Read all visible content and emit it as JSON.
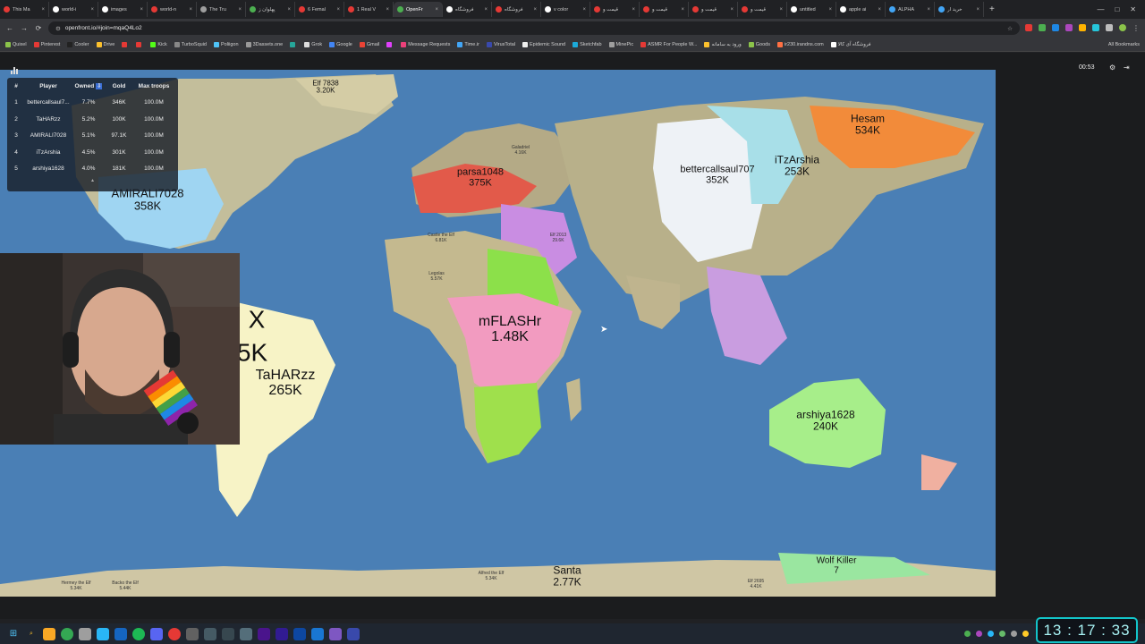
{
  "browser": {
    "tabs": [
      {
        "label": "This Ma",
        "color": "#e53935",
        "active": false
      },
      {
        "label": "world-i",
        "color": "#ffffff",
        "active": false
      },
      {
        "label": "images",
        "color": "#ffffff",
        "active": false
      },
      {
        "label": "world-n",
        "color": "#e53935",
        "active": false
      },
      {
        "label": "The Tru",
        "color": "#9e9e9e",
        "active": false
      },
      {
        "label": "پهلوان ز",
        "color": "#4caf50",
        "active": false
      },
      {
        "label": "6 Femal",
        "color": "#e53935",
        "active": false
      },
      {
        "label": "1 Real V",
        "color": "#e53935",
        "active": false
      },
      {
        "label": "OpenFr",
        "color": "#4caf50",
        "active": true
      },
      {
        "label": "فروشگاه",
        "color": "#ffffff",
        "active": false
      },
      {
        "label": "فروشگاه",
        "color": "#e53935",
        "active": false
      },
      {
        "label": "v color",
        "color": "#ffffff",
        "active": false
      },
      {
        "label": "قیمت و",
        "color": "#e53935",
        "active": false
      },
      {
        "label": "قیمت و",
        "color": "#e53935",
        "active": false
      },
      {
        "label": "قیمت و",
        "color": "#e53935",
        "active": false
      },
      {
        "label": "قیمت و",
        "color": "#e53935",
        "active": false
      },
      {
        "label": "untitled",
        "color": "#ffffff",
        "active": false
      },
      {
        "label": "apple ai",
        "color": "#ffffff",
        "active": false
      },
      {
        "label": "ALPHA",
        "color": "#42a5f5",
        "active": false
      },
      {
        "label": "خرید ار",
        "color": "#42a5f5",
        "active": false
      }
    ],
    "url": "openfront.io/#join=mqaQ4Lo2",
    "bookmarks": [
      {
        "label": "Quixel",
        "color": "#8bc34a"
      },
      {
        "label": "Pinterest",
        "color": "#e53935"
      },
      {
        "label": "Cooler",
        "color": "#222222"
      },
      {
        "label": "Drive",
        "color": "#fbc02d"
      },
      {
        "label": "",
        "color": "#e53935"
      },
      {
        "label": "",
        "color": "#e53935"
      },
      {
        "label": "Kick",
        "color": "#53fc18"
      },
      {
        "label": "TurboSquid",
        "color": "#888888"
      },
      {
        "label": "Poliigon",
        "color": "#4fc3f7"
      },
      {
        "label": "3Dassets.one",
        "color": "#999999"
      },
      {
        "label": "",
        "color": "#26a69a"
      },
      {
        "label": "Grok",
        "color": "#dddddd"
      },
      {
        "label": "Google",
        "color": "#4285f4"
      },
      {
        "label": "Gmail",
        "color": "#ea4335"
      },
      {
        "label": "",
        "color": "#e040fb"
      },
      {
        "label": "Message Requests",
        "color": "#ec407a"
      },
      {
        "label": "Time.ir",
        "color": "#42a5f5"
      },
      {
        "label": "VirusTotal",
        "color": "#3949ab"
      },
      {
        "label": "Epidemic Sound",
        "color": "#eeeeee"
      },
      {
        "label": "Sketchfab",
        "color": "#1caad9"
      },
      {
        "label": "MinePic",
        "color": "#9e9e9e"
      },
      {
        "label": "ASMR For People W...",
        "color": "#e53935"
      },
      {
        "label": "ورود به سامانه",
        "color": "#fbc02d"
      },
      {
        "label": "Goods",
        "color": "#8bc34a"
      },
      {
        "label": "ir230.irandns.com",
        "color": "#ff7043"
      },
      {
        "label": "فروشگاه آی کالا",
        "color": "#ffffff"
      }
    ],
    "all_bookmarks_label": "All Bookmarks"
  },
  "game": {
    "timer": "00:53",
    "leaderboard": {
      "headers": [
        "#",
        "Player",
        "Owned",
        "Gold",
        "Max troops"
      ],
      "rows": [
        {
          "rank": "1",
          "player": "bettercallsaul7...",
          "owned": "7.7%",
          "gold": "346K",
          "troops": "100.0M"
        },
        {
          "rank": "2",
          "player": "TaHARzz",
          "owned": "5.2%",
          "gold": "100K",
          "troops": "100.0M"
        },
        {
          "rank": "3",
          "player": "AMIRALI7028",
          "owned": "5.1%",
          "gold": "97.1K",
          "troops": "100.0M"
        },
        {
          "rank": "4",
          "player": "iTzArshia",
          "owned": "4.5%",
          "gold": "301K",
          "troops": "100.0M"
        },
        {
          "rank": "5",
          "player": "arshiya1628",
          "owned": "4.0%",
          "gold": "181K",
          "troops": "100.0M"
        }
      ]
    },
    "territories": [
      {
        "name": "Elf 7838",
        "value": "3.20K",
        "size": 8
      },
      {
        "name": "AMIRALI7028",
        "value": "358K",
        "size": 13
      },
      {
        "name": "parsa1048",
        "value": "375K",
        "size": 11
      },
      {
        "name": "bettercallsaul707",
        "value": "352K",
        "size": 11
      },
      {
        "name": "iTzArshia",
        "value": "253K",
        "size": 12
      },
      {
        "name": "Hesam",
        "value": "534K",
        "size": 12
      },
      {
        "name": "mFLASHr",
        "value": "1.48K",
        "size": 16
      },
      {
        "name": "TaHARzz",
        "value": "265K",
        "size": 16
      },
      {
        "name": "arshiya1628",
        "value": "240K",
        "size": 12
      },
      {
        "name": "Santa",
        "value": "2.77K",
        "size": 12
      },
      {
        "name": "Wolf Killer",
        "value": "7",
        "size": 10
      }
    ],
    "partial_labels": [
      {
        "text": "X",
        "size": 28
      },
      {
        "text": "5K",
        "size": 28
      }
    ],
    "small_labels": [
      {
        "text": "Galadriel\n4.16K"
      },
      {
        "text": "Elf 2013\n29.6K"
      },
      {
        "text": "Legolas\n5.57K"
      },
      {
        "text": "Castle the Elf\n6.81K"
      },
      {
        "text": "Hermey the Elf\n5.34K"
      },
      {
        "text": "Backo the Elf\n5.44K"
      },
      {
        "text": "Alfred the Elf\n5.34K"
      },
      {
        "text": "Elf 2695\n4.41K"
      }
    ]
  },
  "taskbar": {
    "clock": "13 : 17 : 33"
  }
}
